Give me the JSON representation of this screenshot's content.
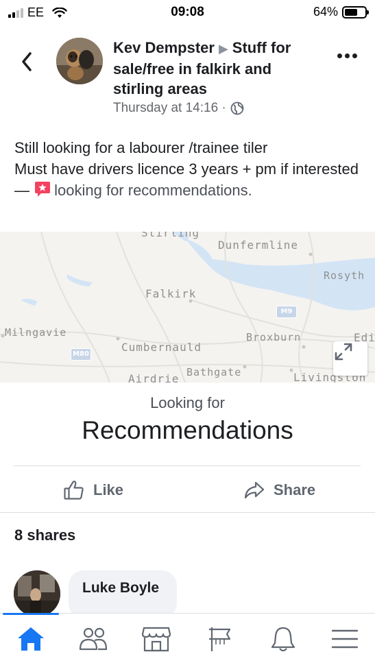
{
  "status_bar": {
    "carrier": "EE",
    "time": "09:08",
    "battery_percent": "64%",
    "battery_level": 0.64,
    "signal_bars": 2
  },
  "post": {
    "author": "Kev Dempster",
    "group": "Stuff for sale/free in falkirk and stirling areas",
    "timestamp": "Thursday at 14:16 ·",
    "privacy_icon": "globe-icon",
    "body_line1": "Still looking for a labourer /trainee tiler",
    "body_line2": "Must have drivers licence 3 years + pm if interested —",
    "activity": "looking for recommendations.",
    "activity_icon": "recommendation-star-icon"
  },
  "map": {
    "labels": [
      "Stirling",
      "Dunfermline",
      "Rosyth",
      "Falkirk",
      "Milngavie",
      "Cumbernauld",
      "Broxburn",
      "Edi",
      "Airdrie",
      "Bathgate",
      "Livingston"
    ],
    "road_signs": [
      "M9",
      "M80"
    ],
    "expand_icon": "expand-icon"
  },
  "recommendation": {
    "subtitle": "Looking for",
    "title": "Recommendations"
  },
  "actions": {
    "like_label": "Like",
    "share_label": "Share"
  },
  "shares_count": "8 shares",
  "comment": {
    "author": "Luke Boyle"
  },
  "nav": {
    "items": [
      "home-icon",
      "friends-icon",
      "marketplace-icon",
      "pages-icon",
      "notifications-icon",
      "menu-icon"
    ],
    "active": "home-icon"
  },
  "colors": {
    "accent": "#1877f2",
    "text": "#1c1e21",
    "secondary_text": "#65676b",
    "recommendation_badge": "#f3425f"
  }
}
